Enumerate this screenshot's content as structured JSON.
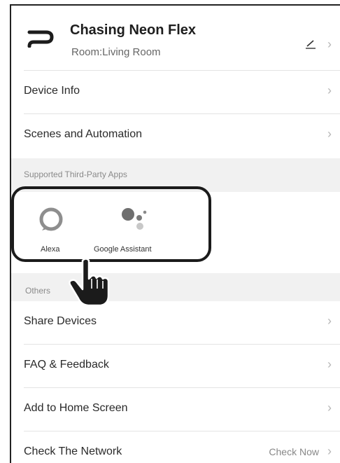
{
  "header": {
    "device_name": "Chasing Neon Flex",
    "room": "Room:Living Room",
    "edit_icon": "pencil-icon",
    "device_icon": "neon-flex-icon"
  },
  "rows_top": [
    {
      "label": "Device Info"
    },
    {
      "label": "Scenes and Automation"
    }
  ],
  "third_party": {
    "section_title": "Supported Third-Party Apps",
    "apps": [
      {
        "name": "Alexa",
        "icon": "alexa-ring-icon"
      },
      {
        "name": "Google Assistant",
        "icon": "google-assistant-dots-icon"
      }
    ]
  },
  "others": {
    "section_title": "Others",
    "rows": [
      {
        "label": "Share Devices"
      },
      {
        "label": "FAQ & Feedback"
      },
      {
        "label": "Add to Home Screen"
      },
      {
        "label": "Check The Network",
        "value": "Check Now"
      }
    ]
  },
  "chevron": "›",
  "colors": {
    "section_bg": "#f1f1f1",
    "chevron": "#b7b7b7",
    "highlight": "#1b1b1b"
  }
}
